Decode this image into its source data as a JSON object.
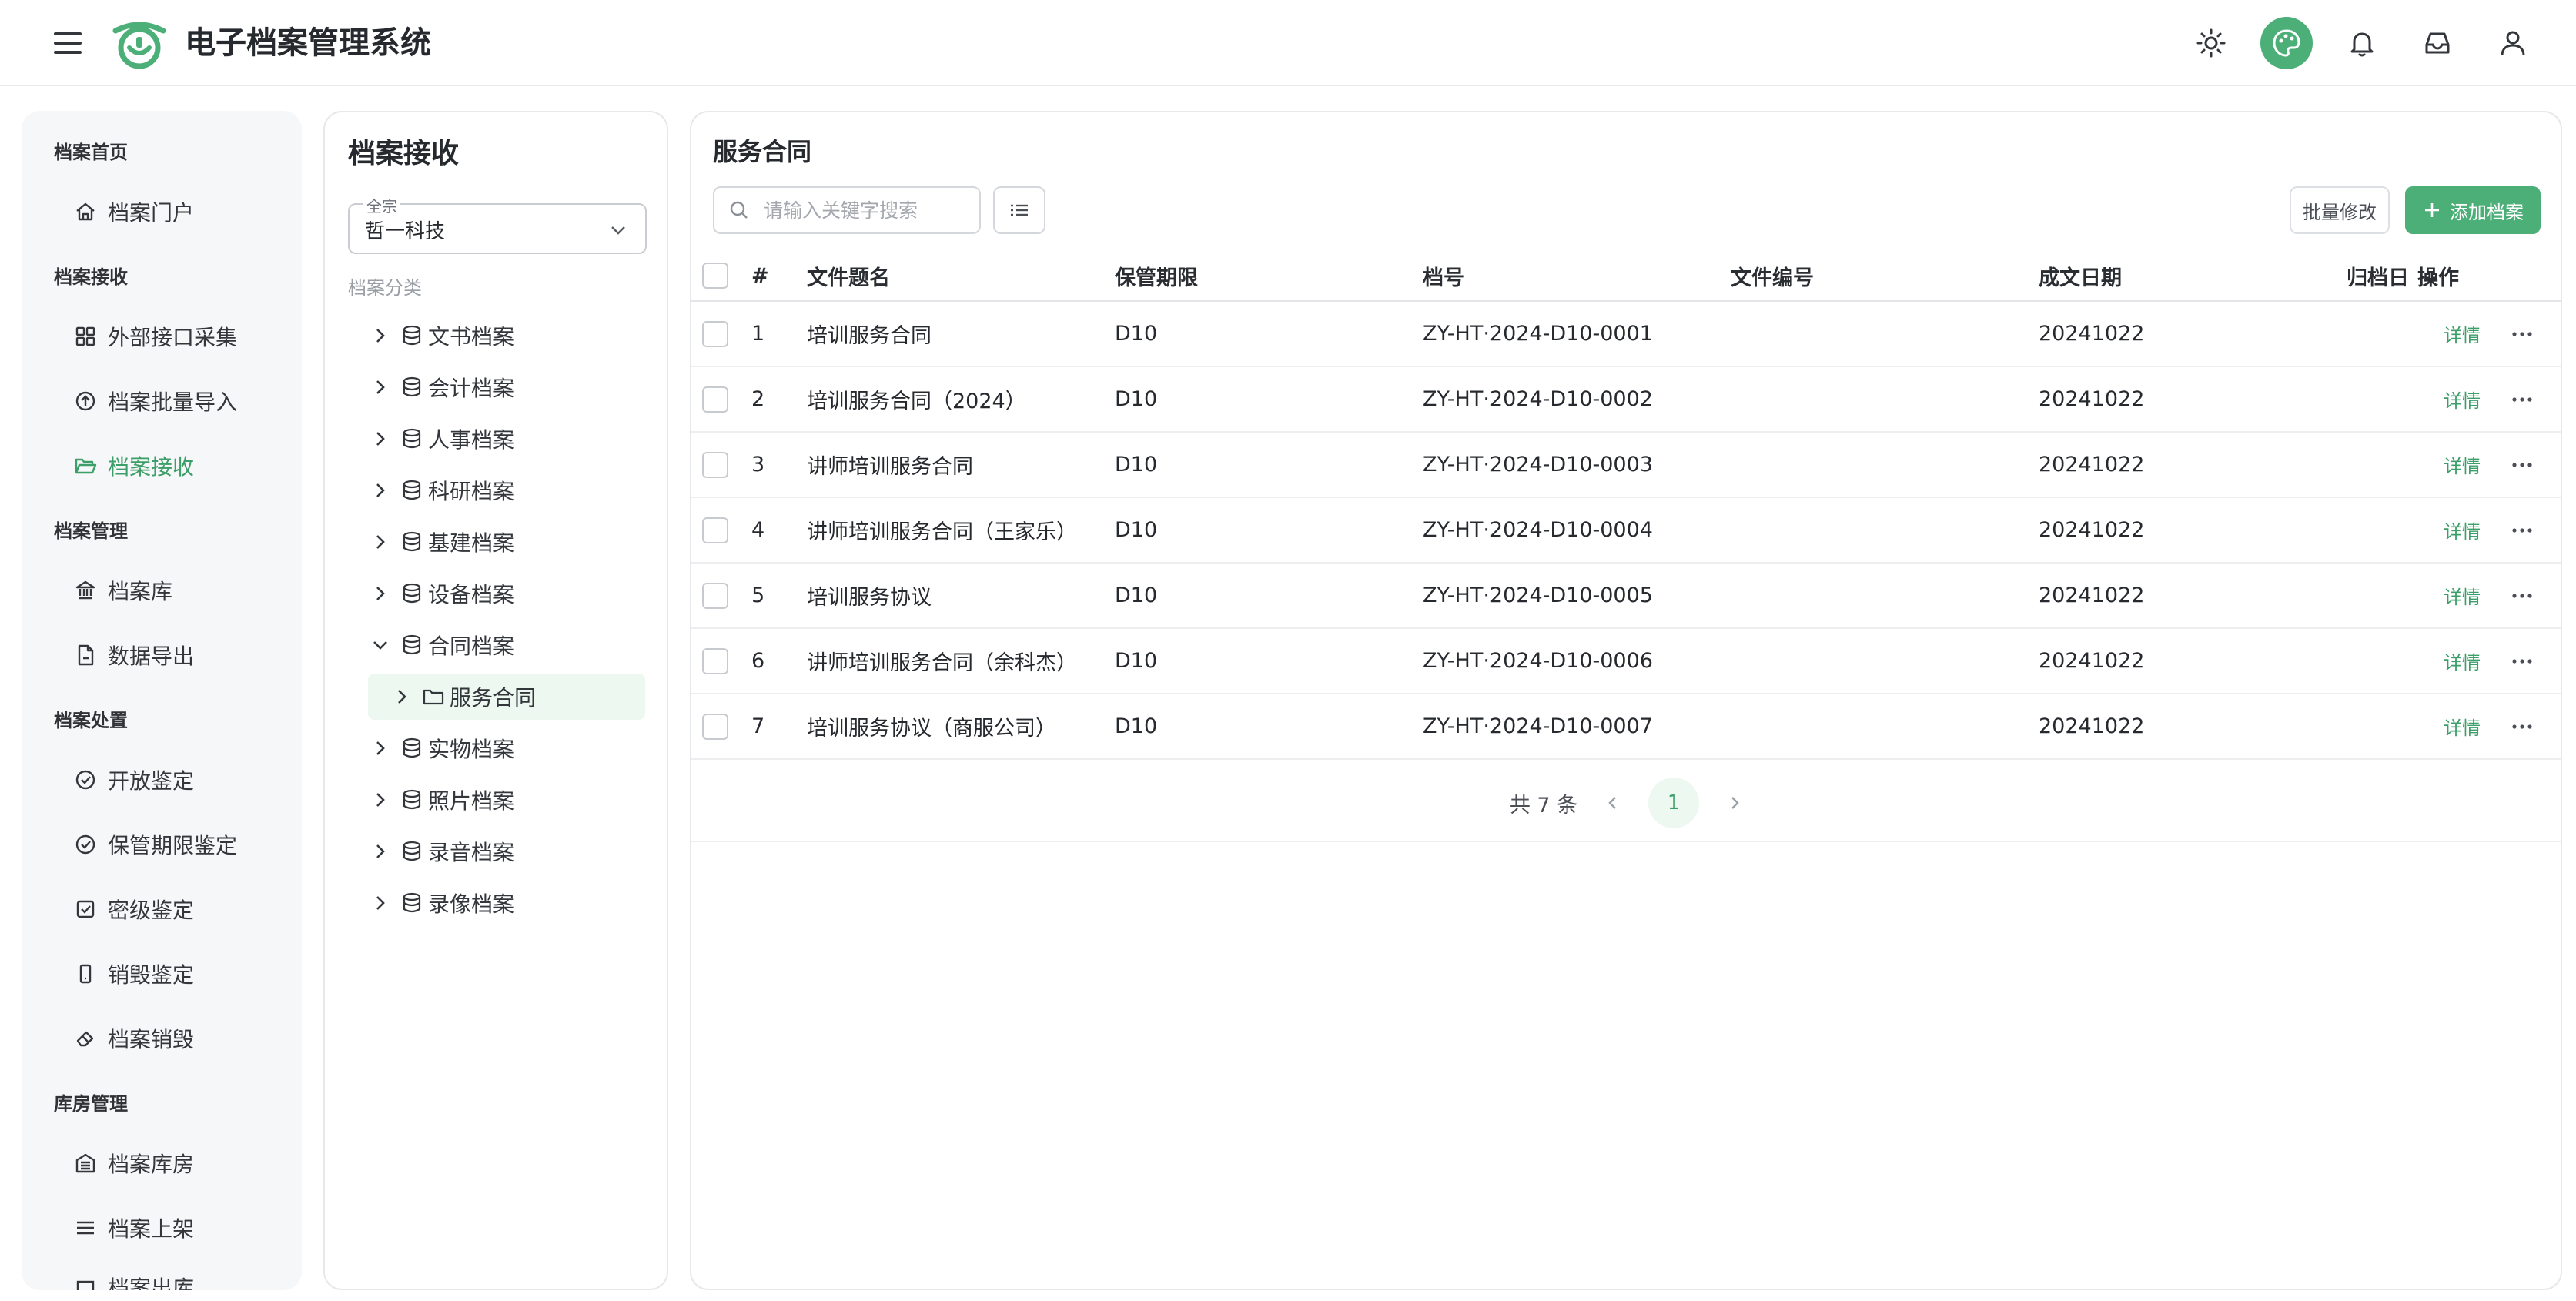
{
  "header": {
    "app_title": "电子档案管理系统"
  },
  "sidebar": {
    "groups": [
      {
        "title": "档案首页",
        "items": [
          {
            "label": "档案门户",
            "icon": "home-icon"
          }
        ]
      },
      {
        "title": "档案接收",
        "items": [
          {
            "label": "外部接口采集",
            "icon": "grid-icon"
          },
          {
            "label": "档案批量导入",
            "icon": "upload-icon"
          },
          {
            "label": "档案接收",
            "icon": "folder-open-icon",
            "active": true
          }
        ]
      },
      {
        "title": "档案管理",
        "items": [
          {
            "label": "档案库",
            "icon": "bank-icon"
          },
          {
            "label": "数据导出",
            "icon": "file-export-icon"
          }
        ]
      },
      {
        "title": "档案处置",
        "items": [
          {
            "label": "开放鉴定",
            "icon": "check-circle-icon"
          },
          {
            "label": "保管期限鉴定",
            "icon": "check-circle-icon"
          },
          {
            "label": "密级鉴定",
            "icon": "check-square-icon"
          },
          {
            "label": "销毁鉴定",
            "icon": "phone-icon"
          },
          {
            "label": "档案销毁",
            "icon": "eraser-icon"
          }
        ]
      },
      {
        "title": "库房管理",
        "items": [
          {
            "label": "档案库房",
            "icon": "warehouse-icon"
          },
          {
            "label": "档案上架",
            "icon": "list-icon"
          },
          {
            "label": "档案出库",
            "icon": "box-icon"
          }
        ]
      }
    ]
  },
  "tree_panel": {
    "title": "档案接收",
    "fonds_select": {
      "legend": "全宗",
      "value": "哲一科技"
    },
    "caption": "档案分类",
    "nodes": [
      "文书档案",
      "会计档案",
      "人事档案",
      "科研档案",
      "基建档案",
      "设备档案",
      "合同档案",
      "服务合同",
      "实物档案",
      "照片档案",
      "录音档案",
      "录像档案"
    ]
  },
  "main": {
    "title": "服务合同",
    "search_placeholder": "请输入关键字搜索",
    "batch_edit_label": "批量修改",
    "add_label": "添加档案",
    "columns": {
      "idx": "#",
      "name": "文件题名",
      "period": "保管期限",
      "code": "档号",
      "file_no": "文件编号",
      "date": "成文日期",
      "archive_date": "归档日",
      "ops": "操作"
    },
    "detail_label": "详情",
    "rows": [
      {
        "idx": "1",
        "name": "培训服务合同",
        "period": "D10",
        "code": "ZY-HT·2024-D10-0001",
        "file_no": "",
        "date": "20241022"
      },
      {
        "idx": "2",
        "name": "培训服务合同（2024）",
        "period": "D10",
        "code": "ZY-HT·2024-D10-0002",
        "file_no": "",
        "date": "20241022"
      },
      {
        "idx": "3",
        "name": "讲师培训服务合同",
        "period": "D10",
        "code": "ZY-HT·2024-D10-0003",
        "file_no": "",
        "date": "20241022"
      },
      {
        "idx": "4",
        "name": "讲师培训服务合同（王家乐）",
        "period": "D10",
        "code": "ZY-HT·2024-D10-0004",
        "file_no": "",
        "date": "20241022"
      },
      {
        "idx": "5",
        "name": "培训服务协议",
        "period": "D10",
        "code": "ZY-HT·2024-D10-0005",
        "file_no": "",
        "date": "20241022"
      },
      {
        "idx": "6",
        "name": "讲师培训服务合同（余科杰）",
        "period": "D10",
        "code": "ZY-HT·2024-D10-0006",
        "file_no": "",
        "date": "20241022"
      },
      {
        "idx": "7",
        "name": "培训服务协议（商服公司）",
        "period": "D10",
        "code": "ZY-HT·2024-D10-0007",
        "file_no": "",
        "date": "20241022"
      }
    ],
    "pagination": {
      "total": "共 7 条",
      "current_page": "1"
    }
  },
  "colors": {
    "accent": "#4caf78",
    "accent_text": "#3c9e68",
    "accent_bg": "#edf8f1"
  }
}
